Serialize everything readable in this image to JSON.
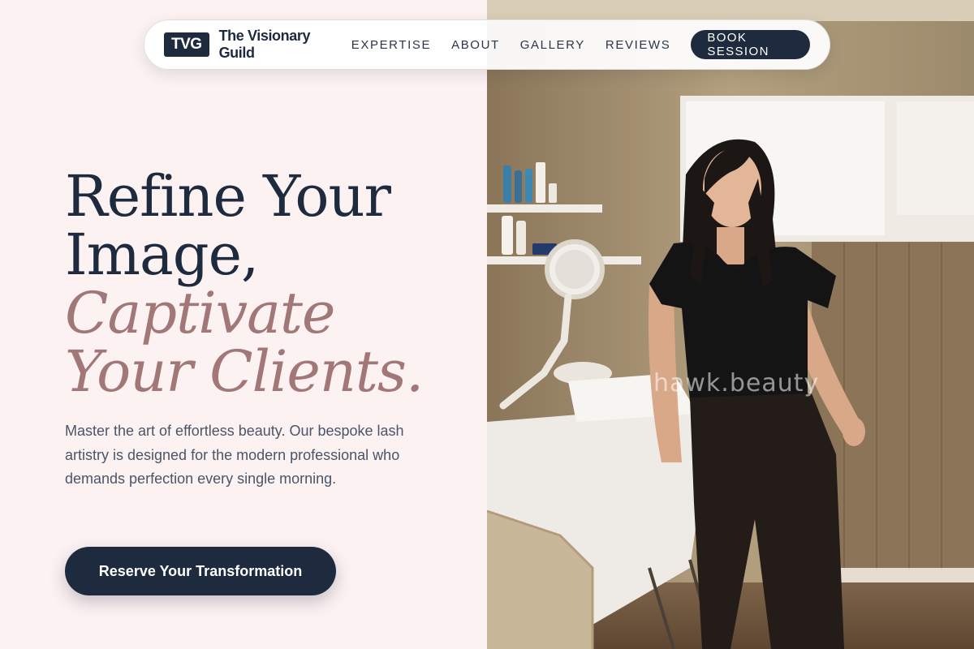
{
  "nav": {
    "logo_mark": "TVG",
    "brand_name": "The Visionary Guild",
    "links": [
      "EXPERTISE",
      "ABOUT",
      "GALLERY",
      "REVIEWS"
    ],
    "cta": "BOOK SESSION"
  },
  "hero": {
    "title_line1": "Refine Your",
    "title_line2": "Image,",
    "title_line3": "Captivate",
    "title_line4": "Your Clients.",
    "body": "Master the art of effortless beauty. Our bespoke lash artistry is designed for the modern professional who demands perfection every single morning.",
    "cta": "Reserve Your Transformation"
  },
  "photo": {
    "watermark": "hawk.beauty"
  },
  "colors": {
    "navy": "#1e2a3e",
    "accent_rose": "#a27777",
    "background": "#fdf2f2"
  }
}
